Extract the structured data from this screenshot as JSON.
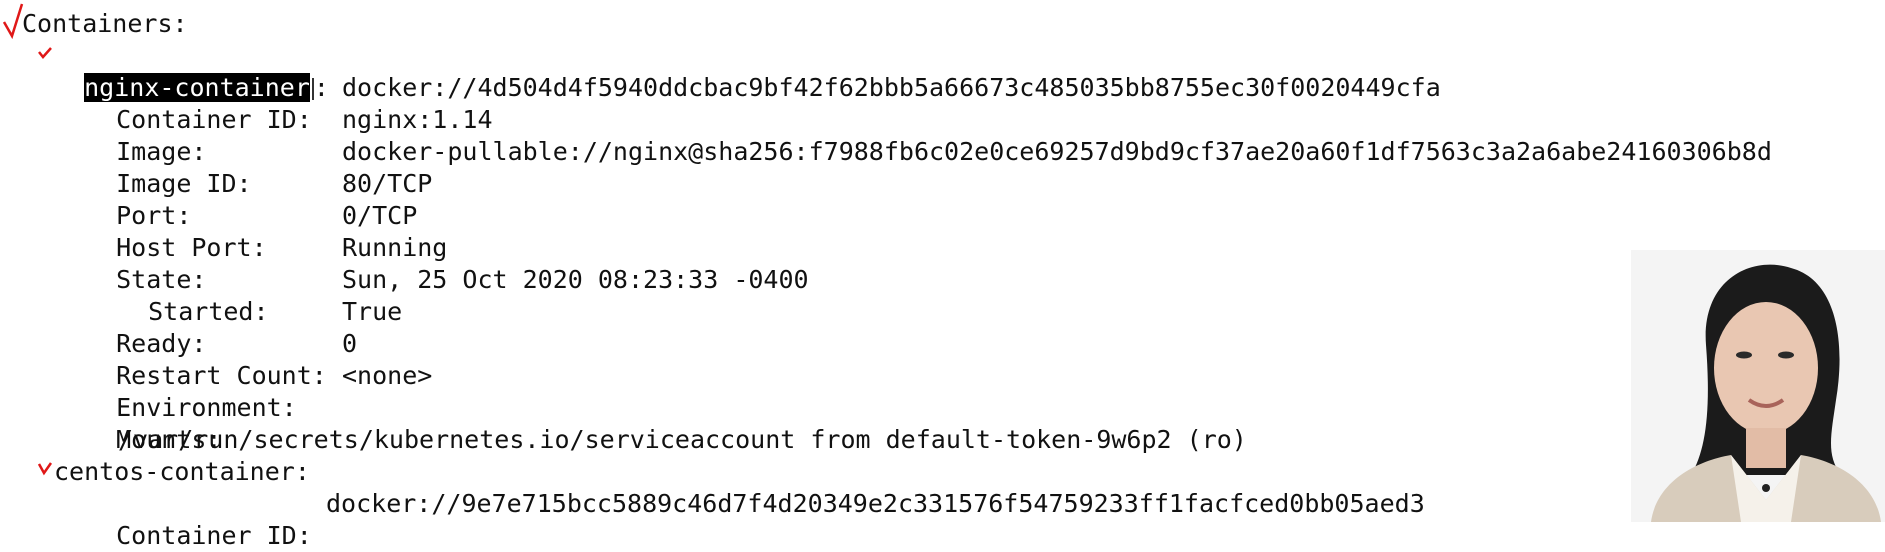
{
  "terminal": {
    "containers_header": "Containers:",
    "c1": {
      "name": "nginx-container",
      "colon": ":",
      "rows": [
        {
          "key": "Container ID:",
          "value": "docker://4d504d4f5940ddcbac9bf42f62bbb5a66673c485035bb8755ec30f0020449cfa"
        },
        {
          "key": "Image:",
          "value": "nginx:1.14"
        },
        {
          "key": "Image ID:",
          "value": "docker-pullable://nginx@sha256:f7988fb6c02e0ce69257d9bd9cf37ae20a60f1df7563c3a2a6abe24160306b8d"
        },
        {
          "key": "Port:",
          "value": "80/TCP"
        },
        {
          "key": "Host Port:",
          "value": "0/TCP"
        },
        {
          "key": "State:",
          "value": "Running"
        },
        {
          "key": "Started:",
          "value": "Sun, 25 Oct 2020 08:23:33 -0400"
        },
        {
          "key": "Ready:",
          "value": "True"
        },
        {
          "key": "Restart Count:",
          "value": "0"
        },
        {
          "key": "Environment:",
          "value": "<none>"
        },
        {
          "key": "Mounts:",
          "value": ""
        }
      ],
      "mount_path": "/var/run/secrets/kubernetes.io/serviceaccount from default-token-9w6p2 (ro)"
    },
    "c2": {
      "name": "centos-container:",
      "rows": [
        {
          "key": "Container ID:",
          "value": "docker://9e7e715bcc5889c46d7f4d20349e2c331576f54759233ff1facfced0bb05aed3"
        }
      ]
    }
  },
  "annotations": {
    "checkmark_color": "#e01818"
  },
  "webcam": {
    "icon": "presenter-video"
  }
}
